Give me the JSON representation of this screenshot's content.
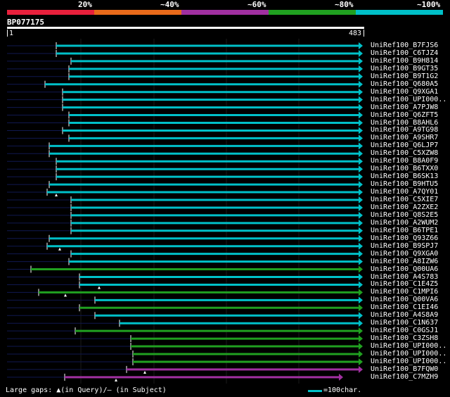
{
  "legend": {
    "segments": [
      {
        "label": "20%",
        "color": "#e8203c"
      },
      {
        "label": "~40%",
        "color": "#e86a1a"
      },
      {
        "label": "~60%",
        "color": "#a030a0"
      },
      {
        "label": "~80%",
        "color": "#20a020"
      },
      {
        "label": "~100%",
        "color": "#00c0c8"
      }
    ]
  },
  "query": {
    "id": "BP077175",
    "start": "1",
    "end": "483"
  },
  "hits": [
    {
      "label": "UniRef100_B7FJS6",
      "start": 80,
      "color": "#00c0c8"
    },
    {
      "label": "UniRef100_C6TJZ4",
      "start": 80,
      "color": "#00c0c8"
    },
    {
      "label": "UniRef100_B9H814",
      "start": 101,
      "color": "#00c0c8"
    },
    {
      "label": "UniRef100_B9GT35",
      "start": 98,
      "color": "#00c0c8"
    },
    {
      "label": "UniRef100_B9T1G2",
      "start": 98,
      "color": "#00c0c8"
    },
    {
      "label": "UniRef100_Q680A5",
      "start": 64,
      "color": "#00c0c8"
    },
    {
      "label": "UniRef100_Q9XGA1",
      "start": 89,
      "color": "#00c0c8"
    },
    {
      "label": "UniRef100_UPI000..",
      "start": 89,
      "color": "#00c0c8"
    },
    {
      "label": "UniRef100_A7PJW8",
      "start": 89,
      "color": "#00c0c8"
    },
    {
      "label": "UniRef100_Q6ZFT5",
      "start": 98,
      "color": "#00c0c8"
    },
    {
      "label": "UniRef100_B8AHL6",
      "start": 98,
      "color": "#00c0c8"
    },
    {
      "label": "UniRef100_A9TG98",
      "start": 89,
      "color": "#00c0c8"
    },
    {
      "label": "UniRef100_A9SHR7",
      "start": 98,
      "color": "#00c0c8"
    },
    {
      "label": "UniRef100_Q6LJP7",
      "start": 70,
      "color": "#00c0c8"
    },
    {
      "label": "UniRef100_C5XZW8",
      "start": 70,
      "color": "#00c0c8"
    },
    {
      "label": "UniRef100_B8A0F9",
      "start": 80,
      "color": "#00c0c8"
    },
    {
      "label": "UniRef100_B6TXX0",
      "start": 80,
      "color": "#00c0c8"
    },
    {
      "label": "UniRef100_B6SK13",
      "start": 80,
      "color": "#00c0c8"
    },
    {
      "label": "UniRef100_B9HTU5",
      "start": 70,
      "color": "#00c0c8"
    },
    {
      "label": "UniRef100_A7QY01",
      "start": 67,
      "color": "#00c0c8",
      "gap": 80
    },
    {
      "label": "UniRef100_C5XIE7",
      "start": 101,
      "color": "#00c0c8"
    },
    {
      "label": "UniRef100_A2ZXE2",
      "start": 101,
      "color": "#00c0c8"
    },
    {
      "label": "UniRef100_Q8S2E5",
      "start": 101,
      "color": "#00c0c8"
    },
    {
      "label": "UniRef100_A2WUM2",
      "start": 101,
      "color": "#00c0c8"
    },
    {
      "label": "UniRef100_B6TPE1",
      "start": 101,
      "color": "#00c0c8"
    },
    {
      "label": "UniRef100_Q93Z66",
      "start": 70,
      "color": "#00c0c8"
    },
    {
      "label": "UniRef100_B9SPJ7",
      "start": 67,
      "color": "#00c0c8",
      "gap": 85
    },
    {
      "label": "UniRef100_Q9XGA0",
      "start": 101,
      "color": "#00c0c8"
    },
    {
      "label": "UniRef100_A8IZW6",
      "start": 98,
      "color": "#00c0c8"
    },
    {
      "label": "UniRef100_Q00UA6",
      "start": 44,
      "color": "#20a020"
    },
    {
      "label": "UniRef100_A4S783",
      "start": 113,
      "color": "#00c0c8"
    },
    {
      "label": "UniRef100_C1E4Z5",
      "start": 113,
      "color": "#00c0c8",
      "gap": 141
    },
    {
      "label": "UniRef100_C1MPI6",
      "start": 55,
      "color": "#20a020",
      "gap": 93
    },
    {
      "label": "UniRef100_Q00VA6",
      "start": 135,
      "color": "#00c0c8"
    },
    {
      "label": "UniRef100_C1EI46",
      "start": 113,
      "color": "#20a020"
    },
    {
      "label": "UniRef100_A4S8A9",
      "start": 135,
      "color": "#00c0c8"
    },
    {
      "label": "UniRef100_C1N637",
      "start": 170,
      "color": "#00c0c8"
    },
    {
      "label": "UniRef100_C0GSJ1",
      "start": 107,
      "color": "#20a020"
    },
    {
      "label": "UniRef100_C3ZSH8",
      "start": 186,
      "color": "#20a020"
    },
    {
      "label": "UniRef100_UPI000..",
      "start": 186,
      "color": "#20a020"
    },
    {
      "label": "UniRef100_UPI000..",
      "start": 189,
      "color": "#20a020"
    },
    {
      "label": "UniRef100_UPI000..",
      "start": 189,
      "color": "#20a020"
    },
    {
      "label": "UniRef100_B7FQW0",
      "start": 180,
      "color": "#a030a0",
      "gap": 206
    },
    {
      "label": "UniRef100_C7MZH9",
      "start": 92,
      "color": "#a030a0",
      "end": 488,
      "gap": 165
    }
  ],
  "footer": {
    "gaps_text": "Large gaps: ▲(in Query)/– (in Subject)",
    "scale_text": "=100char."
  }
}
